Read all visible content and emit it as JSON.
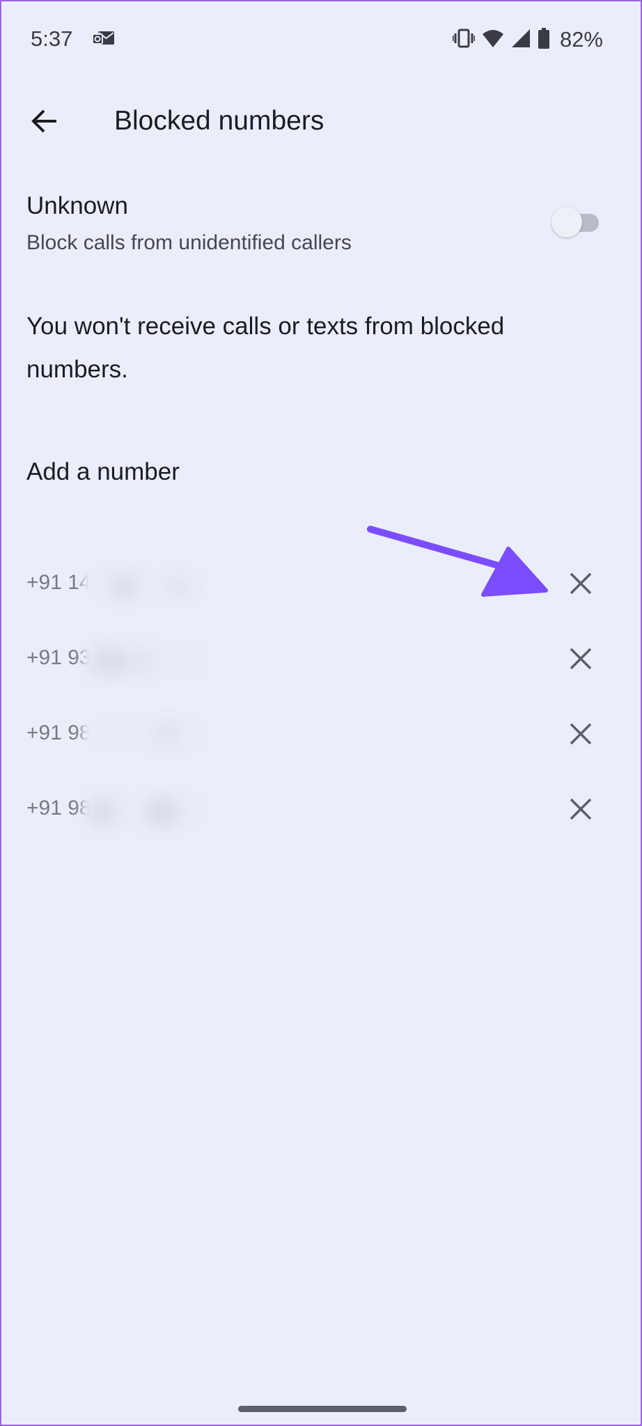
{
  "status_bar": {
    "time": "5:37",
    "battery_percent": "82%",
    "icons": [
      "mail-notification-icon",
      "vibrate-icon",
      "wifi-icon",
      "cell-signal-icon",
      "battery-icon"
    ]
  },
  "app_bar": {
    "back_icon": "arrow-back-icon",
    "title": "Blocked numbers"
  },
  "unknown_setting": {
    "title": "Unknown",
    "subtitle": "Block calls from unidentified callers",
    "enabled": false
  },
  "info_text": "You won't receive calls or texts from blocked numbers.",
  "add_number_label": "Add a number",
  "blocked_numbers": [
    {
      "visible_prefix": "+91 14",
      "remove_icon": "close-icon"
    },
    {
      "visible_prefix": "+91 93",
      "remove_icon": "close-icon"
    },
    {
      "visible_prefix": "+91 98",
      "remove_icon": "close-icon"
    },
    {
      "visible_prefix": "+91 98",
      "remove_icon": "close-icon"
    }
  ],
  "annotation": {
    "arrow_color": "#7c4dff",
    "points_to": "remove-button-1"
  },
  "colors": {
    "background": "#eaeefb",
    "text_primary": "#1b1c22",
    "text_secondary": "#464752",
    "icon": "#5d5f68"
  }
}
